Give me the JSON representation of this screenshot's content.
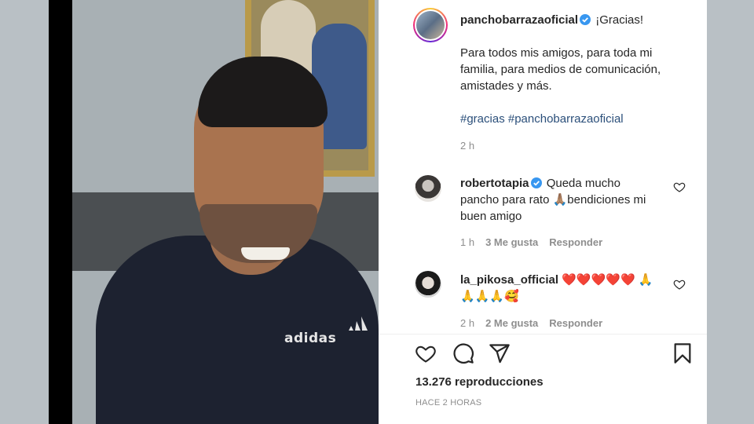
{
  "post": {
    "author": "panchobarrazaoficial",
    "caption_lead": "¡Gracias!",
    "caption_body": "Para todos mis amigos, para toda mi familia, para medios de comunicación, amistades y más.",
    "hashtags": [
      "#gracias",
      "#panchobarrazaoficial"
    ],
    "time": "2 h",
    "video_brand": "adidas"
  },
  "comments": [
    {
      "user": "robertotapia",
      "verified": true,
      "text": "Queda mucho pancho para rato 🙏🏽bendiciones mi buen amigo",
      "time": "1 h",
      "likes": "3 Me gusta",
      "reply": "Responder"
    },
    {
      "user": "la_pikosa_official",
      "verified": false,
      "text": "❤️❤️❤️❤️❤️ 🙏🙏🙏🙏🥰",
      "time": "2 h",
      "likes": "2 Me gusta",
      "reply": "Responder"
    }
  ],
  "footer": {
    "views": "13.276 reproducciones",
    "ago": "HACE 2 HORAS"
  },
  "icons": {
    "like": "heart-outline-icon",
    "comment": "comment-bubble-icon",
    "share": "paper-plane-icon",
    "save": "bookmark-icon",
    "verified": "verified-badge-icon"
  },
  "colors": {
    "verified": "#3897f0",
    "hashtag": "#2b4f7a",
    "meta": "#8e8e8e",
    "text": "#262626"
  }
}
